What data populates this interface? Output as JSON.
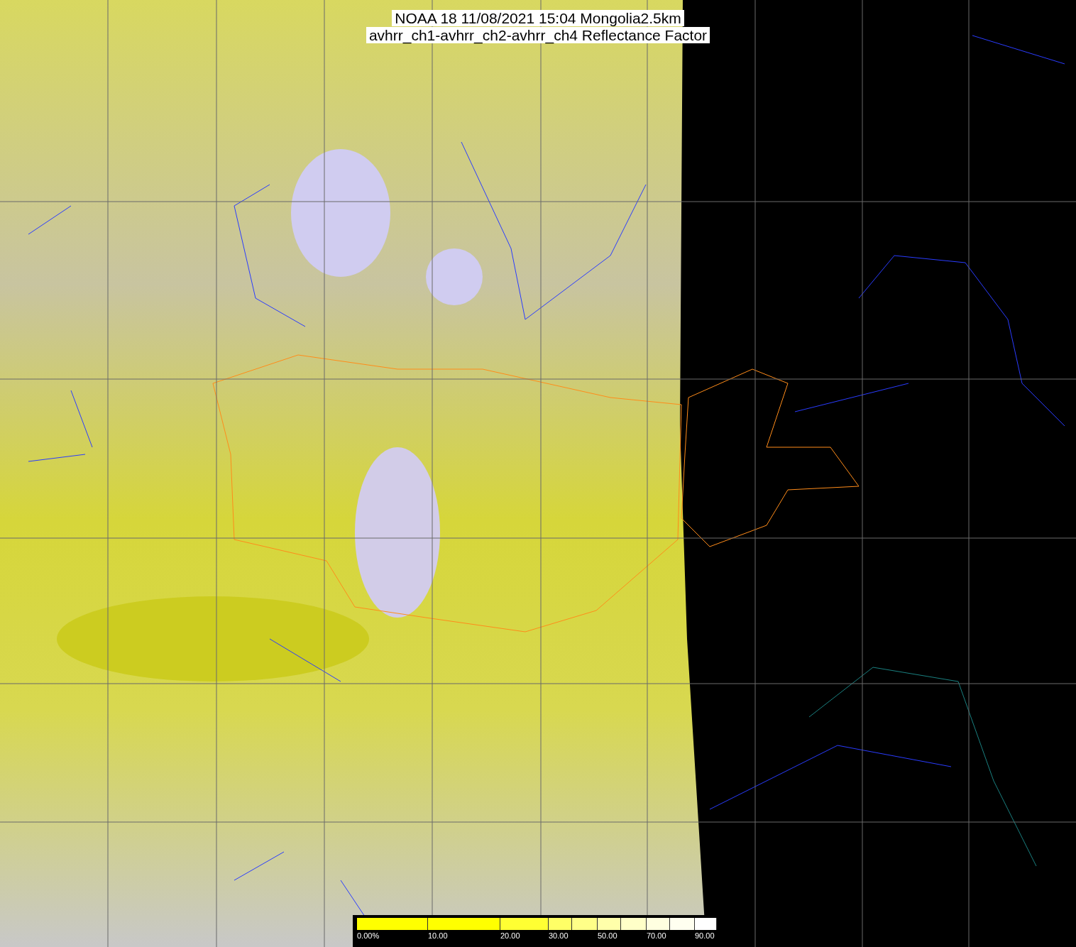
{
  "title": [
    "NOAA 18 11/08/2021 15:04 Mongolia2.5km",
    "avhrr_ch1-avhrr_ch2-avhrr_ch4 Reflectance Factor"
  ],
  "colorbar": {
    "segments": [
      {
        "color": "#ffff00"
      },
      {
        "color": "#ffff00"
      },
      {
        "color": "#ffff33"
      },
      {
        "color": "#ffff66"
      },
      {
        "color": "#ffff88"
      },
      {
        "color": "#ffffaa"
      },
      {
        "color": "#ffffc8"
      },
      {
        "color": "#ffffe0"
      },
      {
        "color": "#fffff0"
      },
      {
        "color": "#ffffff"
      }
    ],
    "labels": [
      "0.00%",
      "10.00",
      "20.00",
      "30.00",
      "50.00",
      "70.00",
      "90.00"
    ]
  }
}
